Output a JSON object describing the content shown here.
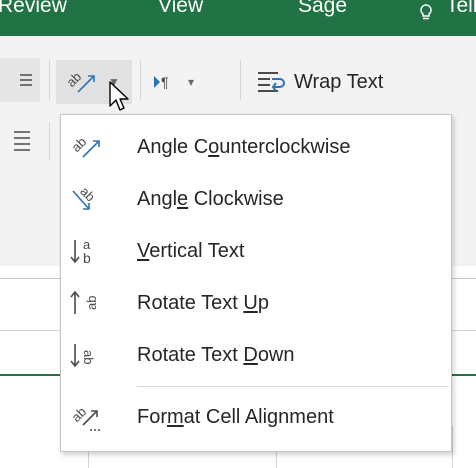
{
  "ribbon_tabs": [
    {
      "label": "Review"
    },
    {
      "label": "View"
    },
    {
      "label": "Sage"
    },
    {
      "label": "Tell me",
      "icon": "lightbulb-icon"
    }
  ],
  "toolbar": {
    "orientation_button": {
      "icon": "angle-counterclockwise-icon",
      "expanded": true
    },
    "text_direction_button": {
      "icon": "text-direction-icon"
    },
    "wrap_text": {
      "icon": "wrap-text-icon",
      "label": "Wrap Text"
    }
  },
  "menu": {
    "items": [
      {
        "icon": "angle-counterclockwise-icon",
        "pre": "Angle C",
        "accel": "o",
        "post": "unterclockwise"
      },
      {
        "icon": "angle-clockwise-icon",
        "pre": "Angl",
        "accel": "e",
        "post": " Clockwise"
      },
      {
        "icon": "vertical-text-icon",
        "pre": "",
        "accel": "V",
        "post": "ertical Text"
      },
      {
        "icon": "rotate-text-up-icon",
        "pre": "Rotate Text ",
        "accel": "U",
        "post": "p"
      },
      {
        "icon": "rotate-text-down-icon",
        "pre": "Rotate Text ",
        "accel": "D",
        "post": "own"
      },
      {
        "icon": "format-cell-alignment-icon",
        "pre": "For",
        "accel": "m",
        "post": "at Cell Alignment"
      }
    ]
  },
  "colors": {
    "ribbon_tab_bar": "#217346",
    "ribbon_body": "#f3f3f3",
    "pressed_button": "#e1e1e1",
    "menu_border": "#c6c6c6",
    "text": "#262626",
    "icon_gray": "#4a4a4a",
    "icon_blue": "#2e74b5"
  }
}
